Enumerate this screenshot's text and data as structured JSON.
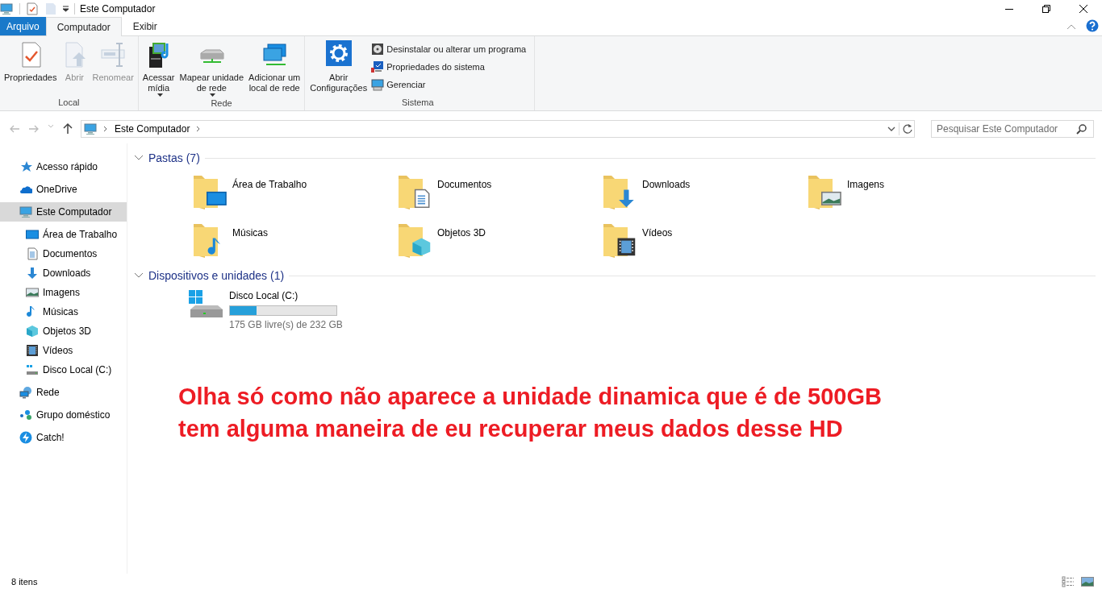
{
  "window": {
    "title": "Este Computador"
  },
  "ribbon": {
    "tabs": [
      {
        "label": "Arquivo",
        "kind": "file",
        "selected": false
      },
      {
        "label": "Computador",
        "kind": "tab",
        "selected": true
      },
      {
        "label": "Exibir",
        "kind": "tab",
        "selected": false
      }
    ],
    "groups": [
      {
        "label": "Local",
        "items": [
          {
            "kind": "large",
            "label": "Propriedades",
            "disabled": false,
            "dropdown": false
          },
          {
            "kind": "large",
            "label": "Abrir",
            "disabled": true,
            "dropdown": false
          },
          {
            "kind": "large",
            "label": "Renomear",
            "disabled": true,
            "dropdown": false
          }
        ]
      },
      {
        "label": "Rede",
        "items": [
          {
            "kind": "large",
            "label": "Acessar\nmídia",
            "disabled": false,
            "dropdown": true
          },
          {
            "kind": "large",
            "label": "Mapear unidade\nde rede",
            "disabled": false,
            "dropdown": true
          },
          {
            "kind": "large",
            "label": "Adicionar um\nlocal de rede",
            "disabled": false,
            "dropdown": false
          }
        ]
      },
      {
        "label": "Sistema",
        "items": [
          {
            "kind": "large",
            "label": "Abrir\nConfigurações",
            "disabled": false,
            "dropdown": false
          },
          {
            "kind": "small",
            "label": "Desinstalar ou alterar um programa",
            "disabled": false,
            "dropdown": false
          },
          {
            "kind": "small",
            "label": "Propriedades do sistema",
            "disabled": false,
            "dropdown": false
          },
          {
            "kind": "small",
            "label": "Gerenciar",
            "disabled": false,
            "dropdown": false
          }
        ]
      }
    ]
  },
  "address": {
    "path": "Este Computador",
    "search_placeholder": "Pesquisar Este Computador"
  },
  "sidebar": {
    "items": [
      {
        "label": "Acesso rápido",
        "selected": false
      },
      {
        "label": "OneDrive",
        "selected": false
      },
      {
        "label": "Este Computador",
        "selected": true,
        "children": [
          {
            "label": "Área de Trabalho",
            "selected": false
          },
          {
            "label": "Documentos",
            "selected": false
          },
          {
            "label": "Downloads",
            "selected": false
          },
          {
            "label": "Imagens",
            "selected": false
          },
          {
            "label": "Músicas",
            "selected": false
          },
          {
            "label": "Objetos 3D",
            "selected": false
          },
          {
            "label": "Vídeos",
            "selected": false
          },
          {
            "label": "Disco Local (C:)",
            "selected": false
          }
        ]
      },
      {
        "label": "Rede",
        "selected": false
      },
      {
        "label": "Grupo doméstico",
        "selected": false
      },
      {
        "label": "Catch!",
        "selected": false
      }
    ]
  },
  "sections": [
    {
      "title": "Pastas (7)",
      "kind": "folders",
      "items": [
        {
          "label": "Área de Trabalho"
        },
        {
          "label": "Documentos"
        },
        {
          "label": "Downloads"
        },
        {
          "label": "Imagens"
        },
        {
          "label": "Músicas"
        },
        {
          "label": "Objetos 3D"
        },
        {
          "label": "Vídeos"
        }
      ]
    },
    {
      "title": "Dispositivos e unidades (1)",
      "kind": "drives",
      "items": [
        {
          "label": "Disco Local (C:)",
          "level": 0.25,
          "reading": "175 GB livre(s) de 232 GB"
        }
      ]
    }
  ],
  "annotation": [
    "Olha só como não aparece a unidade dinamica que é de 500GB",
    "tem alguma maneira de eu recuperar meus dados desse HD"
  ],
  "status_bar": {
    "count": "8 itens"
  }
}
